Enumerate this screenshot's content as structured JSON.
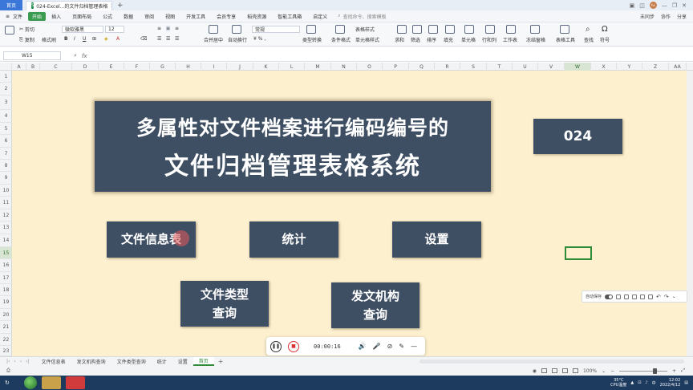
{
  "titlebar": {
    "home_tab": "首页",
    "doc_tab": "024-Excel...的文件归档管理表格",
    "new_tab": "+"
  },
  "menubar": {
    "file": "文件",
    "start": "开始",
    "items": [
      "插入",
      "页面布局",
      "公式",
      "数据",
      "审阅",
      "视图",
      "开发工具",
      "会员专享",
      "稻壳资源",
      "智能工具箱",
      "自定义"
    ],
    "search_placeholder": "查找命令、搜索模板",
    "right": [
      "未同步",
      "协作",
      "分享"
    ]
  },
  "ribbon": {
    "cut": "剪切",
    "copy": "复制",
    "format_painter": "格式刷",
    "font_name": "微软雅黑",
    "font_size": "12",
    "number_format": "常规",
    "merge_center": "合并居中",
    "wrap": "自动换行",
    "type_convert": "类型转换",
    "cond_format": "条件格式",
    "table_style": "表格样式",
    "cell_style": "单元格样式",
    "sum": "求和",
    "filter": "筛选",
    "sort": "排序",
    "fill": "填充",
    "cells": "单元格",
    "rows_cols": "行和列",
    "worksheet": "工作表",
    "freeze": "冻结窗格",
    "table_tools": "表格工具",
    "find": "查找",
    "symbol": "符号"
  },
  "formulabar": {
    "cell_ref": "W15",
    "fx": "fx"
  },
  "columns": [
    "A",
    "B",
    "C",
    "D",
    "E",
    "F",
    "G",
    "H",
    "I",
    "J",
    "K",
    "L",
    "M",
    "N",
    "O",
    "P",
    "Q",
    "R",
    "S",
    "T",
    "U",
    "V",
    "W",
    "X",
    "Y",
    "Z",
    "AA"
  ],
  "selected_column": "W",
  "rows": [
    "1",
    "2",
    "3",
    "4",
    "5",
    "6",
    "7",
    "8",
    "9",
    "10",
    "11",
    "12",
    "13",
    "14",
    "15",
    "16",
    "17",
    "18",
    "19",
    "20",
    "21",
    "22",
    "23"
  ],
  "selected_row": "15",
  "sheet": {
    "title_line1": "多属性对文件档案进行编码编号的",
    "title_line2": "文件归档管理表格系统",
    "number": "024",
    "buttons": {
      "file_info": "文件信息表",
      "stats": "统计",
      "settings": "设置",
      "file_type_query_1": "文件类型",
      "file_type_query_2": "查询",
      "issuer_query_1": "发文机构",
      "issuer_query_2": "查询"
    }
  },
  "float_toolbar": {
    "autosave": "自动保存"
  },
  "recorder": {
    "time": "00:00:16"
  },
  "sheet_tabs": [
    "文件信息表",
    "发文机构查询",
    "文件类型查询",
    "统计",
    "设置",
    "首页"
  ],
  "active_sheet": "首页",
  "statusbar": {
    "zoom": "100%"
  },
  "taskbar": {
    "temp": "35°C",
    "cpu": "CPU温度",
    "time": "12:02",
    "date": "2022/4/12"
  }
}
